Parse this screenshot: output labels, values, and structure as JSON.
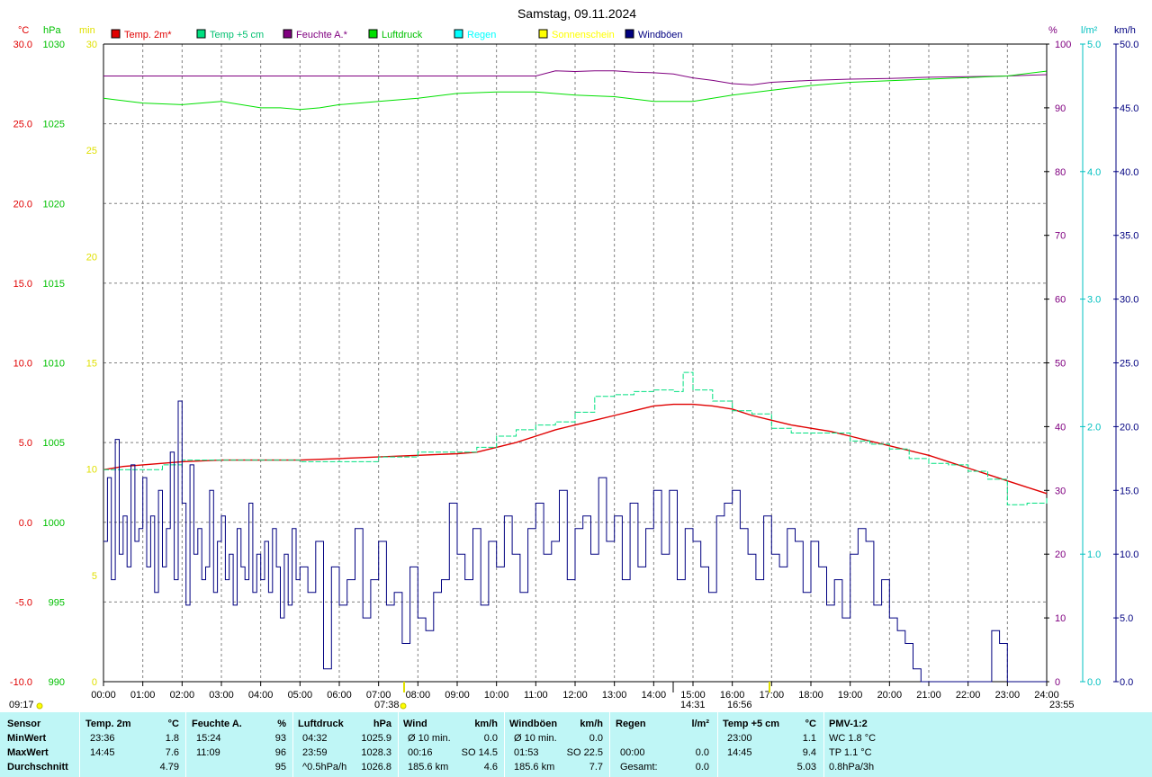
{
  "title": "Samstag, 09.11.2024",
  "colors": {
    "temp2m": "#e00000",
    "temp5": "#00e080",
    "feuchte": "#800080",
    "luftdruck": "#00e000",
    "regen": "#00ffff",
    "sonne": "#ffff00",
    "wind": "#000080",
    "grid": "#808080",
    "stats_bg": "#bff6f6"
  },
  "axis_units": {
    "temp": "°C",
    "pressure": "hPa",
    "minutes": "min",
    "humidity": "%",
    "rain": "l/m²",
    "wind": "km/h"
  },
  "chart_data": {
    "type": "line",
    "title": "Samstag, 09.11.2024",
    "x_ticks": [
      "00:00",
      "01:00",
      "02:00",
      "03:00",
      "04:00",
      "05:00",
      "06:00",
      "07:00",
      "08:00",
      "09:00",
      "10:00",
      "11:00",
      "12:00",
      "13:00",
      "14:00",
      "15:00",
      "16:00",
      "17:00",
      "18:00",
      "19:00",
      "20:00",
      "21:00",
      "22:00",
      "23:00",
      "24:00"
    ],
    "x_range_hours": [
      0,
      24
    ],
    "axes": {
      "temp": {
        "range": [
          -10,
          30
        ],
        "ticks": [
          "-10.0",
          "-5.0",
          "0.0",
          "5.0",
          "10.0",
          "15.0",
          "20.0",
          "25.0",
          "30.0"
        ]
      },
      "pressure": {
        "range": [
          990,
          1030
        ],
        "ticks": [
          "990",
          "995",
          "1000",
          "1005",
          "1010",
          "1015",
          "1020",
          "1025",
          "1030"
        ]
      },
      "minutes": {
        "range": [
          0,
          30
        ],
        "ticks": [
          "0",
          "5",
          "10",
          "15",
          "20",
          "25",
          "30"
        ]
      },
      "humidity": {
        "range": [
          0,
          100
        ],
        "ticks": [
          "0",
          "10",
          "20",
          "30",
          "40",
          "50",
          "60",
          "70",
          "80",
          "90",
          "100"
        ]
      },
      "rain": {
        "range": [
          0,
          5
        ],
        "ticks": [
          "0.0",
          "1.0",
          "2.0",
          "3.0",
          "4.0",
          "5.0"
        ]
      },
      "wind": {
        "range": [
          0,
          50
        ],
        "ticks": [
          "0.0",
          "5.0",
          "10.0",
          "15.0",
          "20.0",
          "25.0",
          "30.0",
          "35.0",
          "40.0",
          "45.0",
          "50.0"
        ]
      }
    },
    "legend": [
      {
        "name": "Temp. 2m*",
        "color": "#e00000"
      },
      {
        "name": "Temp +5 cm",
        "color": "#00e080"
      },
      {
        "name": "Feuchte A.*",
        "color": "#800080"
      },
      {
        "name": "Luftdruck",
        "color": "#00e000"
      },
      {
        "name": "Regen",
        "color": "#00ffff"
      },
      {
        "name": "Sonnenschein",
        "color": "#ffff00"
      },
      {
        "name": "Windböen",
        "color": "#000080"
      }
    ],
    "series": [
      {
        "name": "Temp. 2m*",
        "axis": "temp",
        "x": [
          0,
          0.5,
          1,
          1.5,
          2,
          3,
          4,
          5,
          6,
          7,
          8,
          9,
          9.5,
          10,
          10.5,
          11,
          11.5,
          12,
          12.5,
          13,
          13.5,
          14,
          14.5,
          15,
          15.5,
          16,
          16.5,
          17,
          17.5,
          18,
          18.5,
          19,
          19.5,
          20,
          20.5,
          21,
          21.5,
          22,
          22.5,
          23,
          23.5,
          24
        ],
        "y": [
          3.3,
          3.5,
          3.6,
          3.7,
          3.8,
          3.9,
          3.9,
          3.9,
          4.0,
          4.1,
          4.2,
          4.3,
          4.4,
          4.7,
          5.0,
          5.4,
          5.8,
          6.1,
          6.4,
          6.7,
          7.0,
          7.3,
          7.4,
          7.4,
          7.3,
          7.1,
          6.7,
          6.4,
          6.1,
          5.9,
          5.7,
          5.4,
          5.1,
          4.8,
          4.5,
          4.2,
          3.8,
          3.4,
          3.0,
          2.6,
          2.2,
          1.8
        ]
      },
      {
        "name": "Temp +5 cm",
        "axis": "temp",
        "x": [
          0,
          1,
          1.5,
          2,
          3,
          4,
          5,
          6,
          7,
          8,
          9,
          9.5,
          10,
          10.5,
          11,
          11.5,
          12,
          12.5,
          13,
          13.5,
          14,
          14.5,
          14.75,
          15,
          15.5,
          16,
          16.5,
          17,
          17.5,
          18,
          18.5,
          19,
          19.5,
          20,
          20.5,
          21,
          21.5,
          22,
          22.5,
          23,
          23.5,
          24
        ],
        "y": [
          3.3,
          3.3,
          3.6,
          3.9,
          3.9,
          3.9,
          3.8,
          3.8,
          4.1,
          4.4,
          4.4,
          4.7,
          5.4,
          5.8,
          6.1,
          6.3,
          6.9,
          7.9,
          8.0,
          8.2,
          8.3,
          8.2,
          9.4,
          8.3,
          7.6,
          7.0,
          6.8,
          5.9,
          5.6,
          5.6,
          5.6,
          5.1,
          4.9,
          4.6,
          4.0,
          3.7,
          3.6,
          3.2,
          2.7,
          1.1,
          1.2,
          1.6
        ]
      },
      {
        "name": "Feuchte A.*",
        "axis": "humidity",
        "x": [
          0,
          11,
          11.5,
          12,
          12.5,
          13,
          13.5,
          14,
          14.5,
          15,
          15.5,
          16,
          16.5,
          17,
          18,
          19,
          20,
          21,
          22,
          23,
          24
        ],
        "y": [
          95,
          95,
          95.8,
          95.7,
          95.8,
          95.8,
          95.6,
          95.5,
          95.3,
          94.7,
          94.3,
          93.8,
          93.6,
          94.0,
          94.3,
          94.5,
          94.6,
          94.8,
          94.9,
          95.0,
          95.2
        ]
      },
      {
        "name": "Luftdruck",
        "axis": "pressure",
        "x": [
          0,
          1,
          2,
          3,
          4,
          4.5,
          5,
          5.5,
          6,
          7,
          8,
          9,
          10,
          11,
          12,
          13,
          14,
          15,
          16,
          17,
          18,
          19,
          20,
          21,
          22,
          23,
          23.99
        ],
        "y": [
          1026.6,
          1026.3,
          1026.2,
          1026.4,
          1026.0,
          1026.0,
          1025.9,
          1026.0,
          1026.2,
          1026.4,
          1026.6,
          1026.9,
          1027.0,
          1027.0,
          1026.8,
          1026.7,
          1026.4,
          1026.4,
          1026.8,
          1027.1,
          1027.4,
          1027.6,
          1027.7,
          1027.8,
          1027.9,
          1028.0,
          1028.3
        ]
      },
      {
        "name": "Windböen",
        "axis": "wind",
        "x": [
          0,
          0.1,
          0.2,
          0.3,
          0.4,
          0.5,
          0.6,
          0.7,
          0.8,
          0.9,
          1.0,
          1.1,
          1.2,
          1.3,
          1.4,
          1.5,
          1.6,
          1.7,
          1.8,
          1.9,
          2.0,
          2.1,
          2.2,
          2.3,
          2.4,
          2.5,
          2.6,
          2.7,
          2.8,
          2.9,
          3.0,
          3.1,
          3.2,
          3.3,
          3.4,
          3.5,
          3.6,
          3.7,
          3.8,
          3.9,
          4.0,
          4.1,
          4.2,
          4.3,
          4.4,
          4.5,
          4.6,
          4.7,
          4.8,
          4.9,
          5.0,
          5.2,
          5.4,
          5.6,
          5.8,
          6.0,
          6.2,
          6.4,
          6.6,
          6.8,
          7.0,
          7.2,
          7.4,
          7.6,
          7.8,
          8.0,
          8.2,
          8.4,
          8.6,
          8.8,
          9.0,
          9.2,
          9.4,
          9.6,
          9.8,
          10.0,
          10.2,
          10.4,
          10.6,
          10.8,
          11.0,
          11.2,
          11.4,
          11.6,
          11.8,
          12.0,
          12.2,
          12.4,
          12.6,
          12.8,
          13.0,
          13.2,
          13.4,
          13.6,
          13.8,
          14.0,
          14.2,
          14.4,
          14.6,
          14.8,
          15.0,
          15.2,
          15.4,
          15.6,
          15.8,
          16.0,
          16.2,
          16.4,
          16.6,
          16.8,
          17.0,
          17.2,
          17.4,
          17.6,
          17.8,
          18.0,
          18.2,
          18.4,
          18.6,
          18.8,
          19.0,
          19.2,
          19.4,
          19.6,
          19.8,
          20.0,
          20.2,
          20.4,
          20.6,
          20.8,
          21.0,
          21.2,
          21.4,
          21.6,
          21.8,
          22.0,
          22.2,
          22.4,
          22.6,
          22.8,
          23.0,
          23.2,
          23.4,
          23.6,
          23.8,
          24.0
        ],
        "y": [
          11,
          16,
          8,
          19,
          10,
          13,
          9,
          17,
          11,
          12,
          16,
          9,
          13,
          7,
          15,
          9,
          12,
          18,
          8,
          22,
          14,
          6,
          17,
          10,
          12,
          8,
          9,
          15,
          7,
          11,
          13,
          8,
          10,
          6,
          12,
          9,
          8,
          14,
          7,
          10,
          8,
          11,
          7,
          12,
          9,
          5,
          10,
          6,
          12,
          8,
          9,
          7,
          11,
          1,
          9,
          6,
          8,
          12,
          5,
          8,
          11,
          6,
          7,
          3,
          9,
          5,
          4,
          7,
          8,
          14,
          10,
          8,
          12,
          6,
          11,
          9,
          13,
          10,
          7,
          12,
          14,
          10,
          11,
          15,
          8,
          12,
          13,
          10,
          16,
          11,
          13,
          8,
          14,
          9,
          12,
          15,
          10,
          15,
          8,
          12,
          11,
          9,
          7,
          13,
          14,
          15,
          12,
          10,
          8,
          13,
          10,
          9,
          12,
          11,
          7,
          11,
          9,
          6,
          8,
          5,
          10,
          12,
          11,
          6,
          8,
          5,
          4,
          3,
          1,
          0,
          0,
          0,
          0,
          0,
          0,
          0,
          0,
          0,
          4,
          3,
          0,
          0,
          0,
          0,
          0,
          0
        ]
      }
    ]
  },
  "bottom_labels": {
    "sun_rise_left": "09:17",
    "sun_rise": "07:38",
    "max_marker": "14:31",
    "sun_set": "16:56",
    "end_marker": "23:55"
  },
  "stats": {
    "col_sensor": {
      "header": "Sensor",
      "rows": [
        "MinWert",
        "MaxWert",
        "Durchschnitt"
      ]
    },
    "col_temp2m": {
      "header": "Temp. 2m",
      "unit": "°C",
      "r1_time": "23:36",
      "r1_val": "1.8",
      "r2_time": "14:45",
      "r2_val": "7.6",
      "r3_val": "4.79"
    },
    "col_feuchte": {
      "header": "Feuchte A.",
      "unit": "%",
      "r1_time": "15:24",
      "r1_val": "93",
      "r2_time": "11:09",
      "r2_val": "96",
      "r3_val": "95"
    },
    "col_luftdruck": {
      "header": "Luftdruck",
      "unit": "hPa",
      "r1_time": "04:32",
      "r1_val": "1025.9",
      "r2_time": "23:59",
      "r2_val": "1028.3",
      "r3_label": "^0.5hPa/h",
      "r3_val": "1026.8"
    },
    "col_wind": {
      "header": "Wind",
      "unit": "km/h",
      "r1_label": "Ø 10 min.",
      "r1_val": "0.0",
      "r2_time": "00:16",
      "r2_val": "SO 14.5",
      "r3_label": "185.6 km",
      "r3_val": "4.6"
    },
    "col_boeen": {
      "header": "Windböen",
      "unit": "km/h",
      "r1_label": "Ø 10 min.",
      "r1_val": "0.0",
      "r2_time": "01:53",
      "r2_val": "SO 22.5",
      "r3_label": "185.6 km",
      "r3_val": "7.7"
    },
    "col_regen": {
      "header": "Regen",
      "unit": "l/m²",
      "r2_time": "00:00",
      "r2_val": "0.0",
      "r3_label": "Gesamt:",
      "r3_val": "0.0"
    },
    "col_temp5": {
      "header": "Temp +5 cm",
      "unit": "°C",
      "r1_time": "23:00",
      "r1_val": "1.1",
      "r2_time": "14:45",
      "r2_val": "9.4",
      "r3_val": "5.03"
    },
    "col_pmv": {
      "header": "PMV-1:2",
      "r1": "WC 1.8 °C",
      "r2": "TP 1.1 °C",
      "r3": "0.8hPa/3h"
    }
  }
}
